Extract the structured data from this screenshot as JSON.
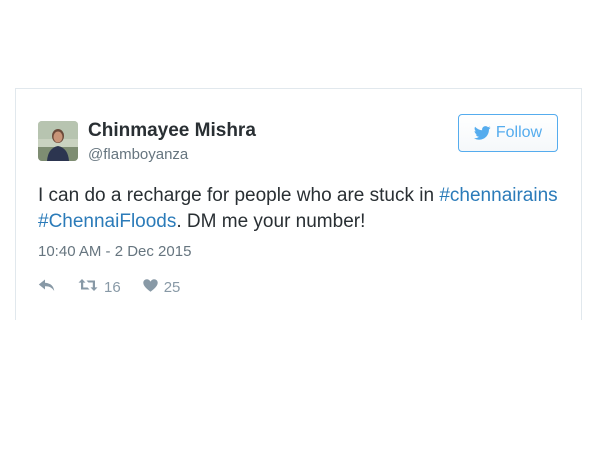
{
  "tweet": {
    "author_name": "Chinmayee Mishra",
    "author_handle": "@flamboyanza",
    "follow_label": "Follow",
    "text_parts": {
      "p1": "I can do a recharge for people who are stuck in ",
      "h1": "#chennairains",
      "h2": "#ChennaiFloods",
      "p2": ". DM me your number!"
    },
    "timestamp": "10:40 AM - 2 Dec 2015",
    "retweet_count": "16",
    "like_count": "25"
  },
  "colors": {
    "accent": "#55acee",
    "link": "#2b7bb9",
    "text": "#292f33",
    "muted": "#66757f",
    "action_icon": "#8899a6",
    "border": "#e1e8ed"
  },
  "icons": {
    "follow": "twitter-bird-icon",
    "reply": "reply-icon",
    "retweet": "retweet-icon",
    "like": "heart-icon"
  }
}
